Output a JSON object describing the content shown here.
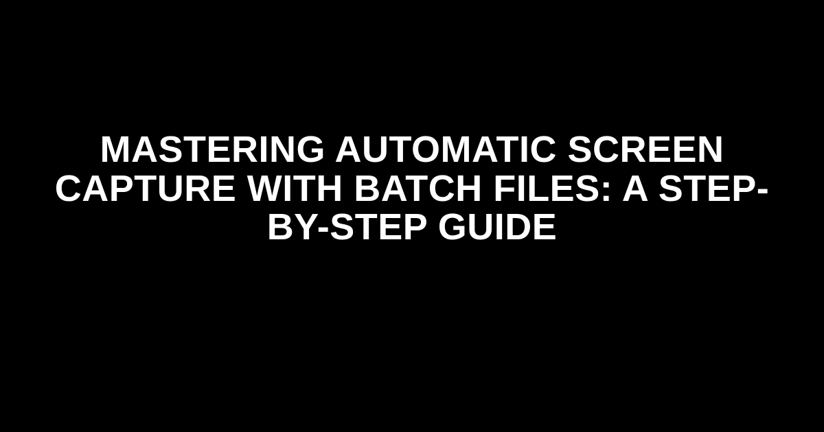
{
  "title": "Mastering Automatic Screen Capture with Batch Files: A Step-by-Step Guide",
  "colors": {
    "background": "#000000",
    "text": "#ffffff"
  }
}
